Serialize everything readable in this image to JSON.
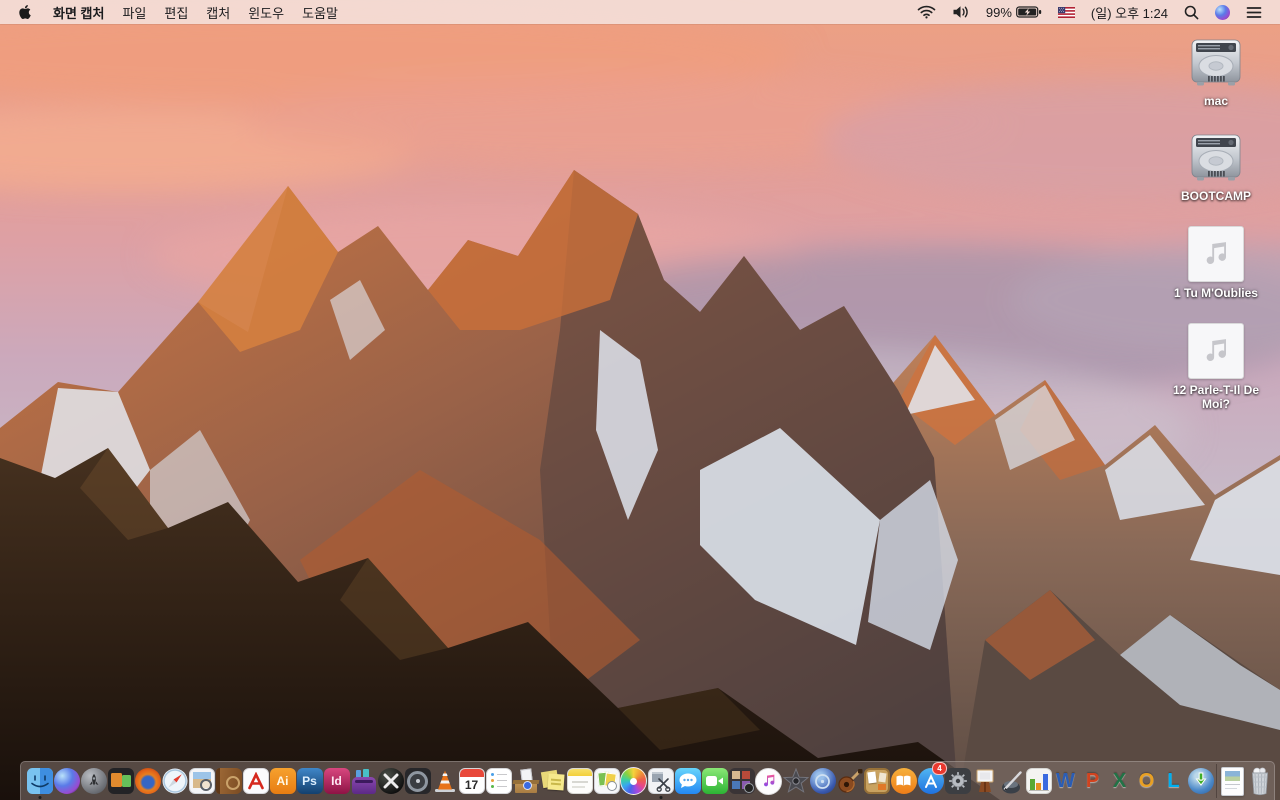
{
  "menubar": {
    "app_menu": "화면 캡처",
    "menus": [
      "파일",
      "편집",
      "캡처",
      "윈도우",
      "도움말"
    ],
    "status": {
      "battery_percent": "99%",
      "battery_state": "charging",
      "clock": "(일) 오후 1:24"
    },
    "status_icons": [
      "wifi-icon",
      "volume-icon",
      "battery-charging-icon",
      "us-flag-icon",
      "spotlight-search-icon",
      "siri-icon",
      "notification-center-icon"
    ]
  },
  "desktop": {
    "icons": [
      {
        "label": "mac",
        "type": "hard-drive"
      },
      {
        "label": "BOOTCAMP",
        "type": "hard-drive"
      },
      {
        "label": "1 Tu M'Oublies",
        "type": "audio-file"
      },
      {
        "label": "12 Parle-T-Il De Moi?",
        "type": "audio-file"
      }
    ]
  },
  "dock": {
    "calendar_day": "17",
    "app_store_badge": "4",
    "letters": {
      "illustrator": "Ai",
      "photoshop": "Ps",
      "indesign": "Id",
      "word": "W",
      "powerpoint": "P",
      "excel": "X",
      "outlook": "O",
      "lync": "L"
    },
    "running_apps": [
      "finder",
      "screen-capture"
    ],
    "trash_state": "full",
    "items": [
      "finder",
      "siri",
      "launchpad",
      "display-mirroring-app",
      "firefox",
      "safari",
      "preview",
      "contacts",
      "acrobat-reader",
      "illustrator",
      "photoshop",
      "indesign",
      "toast-titanium",
      "x-converter-app",
      "disk-utility-app",
      "vlc",
      "calendar",
      "reminders",
      "unarchiver",
      "stickies",
      "notes",
      "image-cards-app",
      "photos",
      "screen-capture",
      "messages",
      "facetime",
      "photo-booth",
      "itunes",
      "imovie",
      "idvd",
      "garageband",
      "corkboard-app",
      "ibooks",
      "app-store",
      "system-preferences",
      "keynote",
      "pages",
      "numbers",
      "word",
      "powerpoint",
      "excel",
      "outlook",
      "lync",
      "web-downloader",
      "document-file",
      "trash"
    ]
  },
  "colors": {
    "menubar_bg": "#f3dcd5",
    "dock_bg": "#80706b",
    "sky_top": "#eb9e82",
    "cloud_purple": "#a593a9",
    "sunlit_rock": "#c76f3e",
    "shadow_rock": "#4e403c",
    "snow": "#e6e9f0",
    "foreground_rock": "#241a13"
  }
}
